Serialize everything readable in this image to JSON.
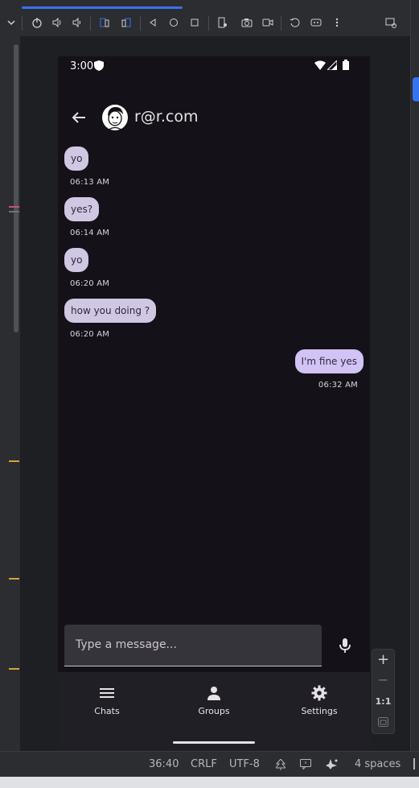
{
  "device": {
    "status_time": "3:00"
  },
  "chat": {
    "contact": "r@r.com",
    "messages": [
      {
        "text": "yo",
        "time": "06:13 AM",
        "direction": "received"
      },
      {
        "text": "yes?",
        "time": "06:14 AM",
        "direction": "received"
      },
      {
        "text": "yo",
        "time": "06:20 AM",
        "direction": "received"
      },
      {
        "text": "how you doing ?",
        "time": "06:20 AM",
        "direction": "received"
      },
      {
        "text": "I'm fine yes",
        "time": "06:32 AM",
        "direction": "sent"
      }
    ],
    "input_placeholder": "Type a message..."
  },
  "nav": {
    "items": [
      {
        "label": "Chats",
        "icon": "menu-icon"
      },
      {
        "label": "Groups",
        "icon": "person-icon"
      },
      {
        "label": "Settings",
        "icon": "gear-icon"
      }
    ]
  },
  "zoom": {
    "plus": "+",
    "minus": "−",
    "one_to_one": "1:1"
  },
  "ide_status": {
    "position": "36:40",
    "line_ending": "CRLF",
    "encoding": "UTF-8",
    "indent": "4 spaces"
  },
  "colors": {
    "accent": "#3574f0",
    "phone_bg": "#141218",
    "received_bubble": "#d0c7e3",
    "sent_bubble": "#d2c3f5"
  }
}
